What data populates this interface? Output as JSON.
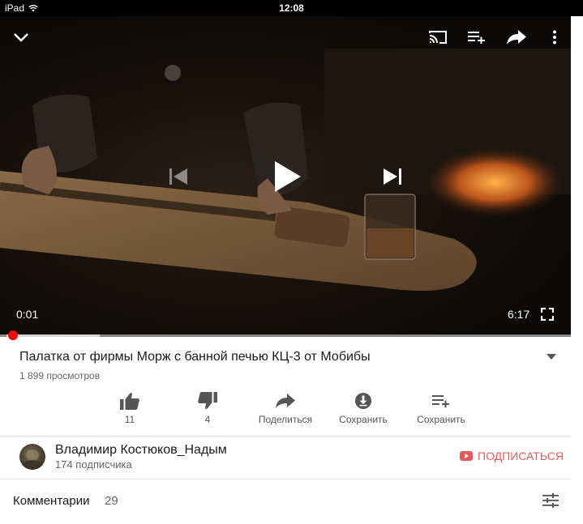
{
  "status_bar": {
    "carrier": "iPad",
    "time": "12:08"
  },
  "player": {
    "current_time": "0:01",
    "duration": "6:17",
    "progress_fraction": 0.011,
    "buffered_fraction": 0.175
  },
  "video": {
    "title": "Палатка от фирмы Морж с банной печью КЦ-3 от Мобибы",
    "views": "1 899 просмотров"
  },
  "actions": {
    "like": "11",
    "dislike": "4",
    "share": "Поделиться",
    "download": "Сохранить",
    "save": "Сохранить"
  },
  "channel": {
    "name": "Владимир Костюков_Надым",
    "subscribers": "174 подписчика",
    "subscribe": "ПОДПИСАТЬСЯ"
  },
  "comments": {
    "label": "Комментарии",
    "count": "29"
  },
  "colors": {
    "accent": "#ff0000",
    "subscribe": "#e85a5a",
    "icon_gray": "#555555"
  },
  "icons": [
    "wifi-icon",
    "collapse-icon",
    "cast-icon",
    "add-to-queue-icon",
    "share-icon",
    "more-icon",
    "previous-icon",
    "play-icon",
    "next-icon",
    "fullscreen-icon",
    "thumbs-up-icon",
    "thumbs-down-icon",
    "download-icon",
    "playlist-add-icon",
    "youtube-icon",
    "sort-icon"
  ]
}
